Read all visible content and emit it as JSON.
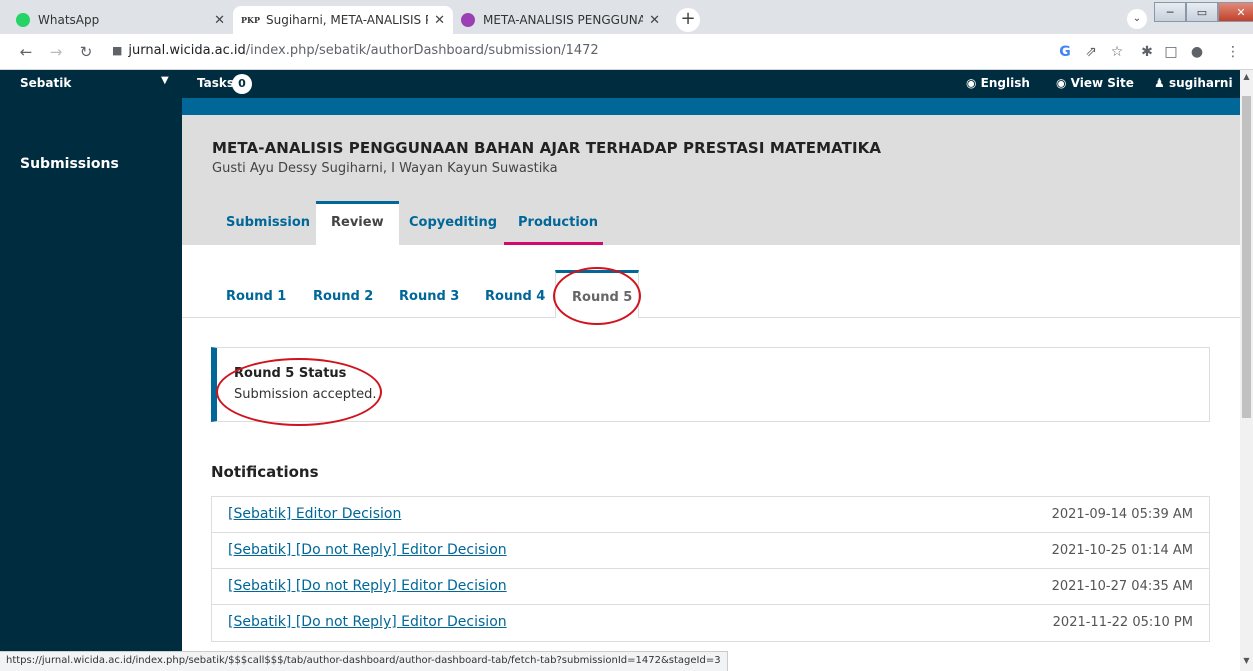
{
  "browser": {
    "tabs": [
      {
        "title": "WhatsApp",
        "icon": "whatsapp-icon"
      },
      {
        "title": "Sugiharni, META-ANALISIS PENG",
        "icon": "pkp-icon",
        "prefix": "PKP"
      },
      {
        "title": "META-ANALISIS PENGGUNAAN B",
        "icon": "ojs-icon"
      }
    ],
    "url_host": "jurnal.wicida.ac.id",
    "url_path": "/index.php/sebatik/authorDashboard/submission/1472",
    "status_url": "https://jurnal.wicida.ac.id/index.php/sebatik/$$$call$$$/tab/author-dashboard/author-dashboard-tab/fetch-tab?submissionId=1472&stageId=3"
  },
  "header": {
    "context_name": "Sebatik",
    "tasks_label": "Tasks",
    "tasks_count": "0",
    "language": "English",
    "view_site": "View Site",
    "user": "sugiharni"
  },
  "sidebar": {
    "items": [
      {
        "label": "Submissions"
      }
    ]
  },
  "submission": {
    "title": "META-ANALISIS PENGGUNAAN BAHAN AJAR TERHADAP PRESTASI MATEMATIKA",
    "authors": "Gusti Ayu Dessy Sugiharni, I Wayan Kayun Suwastika"
  },
  "stage_tabs": [
    {
      "label": "Submission"
    },
    {
      "label": "Review"
    },
    {
      "label": "Copyediting"
    },
    {
      "label": "Production"
    }
  ],
  "round_tabs": [
    {
      "label": "Round 1"
    },
    {
      "label": "Round 2"
    },
    {
      "label": "Round 3"
    },
    {
      "label": "Round 4"
    },
    {
      "label": "Round 5"
    }
  ],
  "round_status": {
    "title": "Round 5 Status",
    "text": "Submission accepted."
  },
  "notifications": {
    "heading": "Notifications",
    "items": [
      {
        "subject": "[Sebatik] Editor Decision",
        "date": "2021-09-14 05:39 AM"
      },
      {
        "subject": "[Sebatik] [Do not Reply] Editor Decision",
        "date": "2021-10-25 01:14 AM"
      },
      {
        "subject": "[Sebatik] [Do not Reply] Editor Decision",
        "date": "2021-10-27 04:35 AM"
      },
      {
        "subject": "[Sebatik] [Do not Reply] Editor Decision",
        "date": "2021-11-22 05:10 PM"
      }
    ]
  },
  "colors": {
    "header_bg": "#002c40",
    "accent": "#006798",
    "production_accent": "#d00a6c",
    "annotation": "#d1131d"
  }
}
